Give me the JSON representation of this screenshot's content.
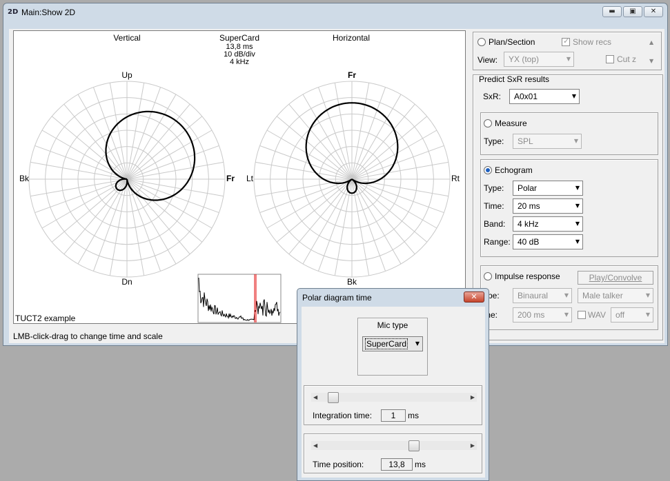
{
  "window": {
    "icon_text": "2D",
    "title": "Main:Show 2D",
    "minimize_glyph": "▬",
    "maximize_glyph": "▣",
    "close_glyph": "✕"
  },
  "plot": {
    "header": {
      "mic_type": "SuperCard",
      "time": "13,8 ms",
      "scale": "10 dB/div",
      "band": "4 kHz"
    },
    "vertical": {
      "title": "Vertical",
      "top": "Up",
      "bottom": "Dn",
      "left": "Bk",
      "right": "Fr"
    },
    "horizontal": {
      "title": "Horizontal",
      "top": "Fr",
      "bottom": "Bk",
      "left": "Lt",
      "right": "Rt"
    },
    "example_label": "TUCT2 example"
  },
  "status_text": "LMB-click-drag to change time and scale",
  "panel": {
    "plan_section_label": "Plan/Section",
    "show_recs_label": "Show recs",
    "view_label": "View:",
    "view_value": "YX (top)",
    "cut_z_label": "Cut z",
    "predict_title": "Predict SxR results",
    "sxr_label": "SxR:",
    "sxr_value": "A0x01",
    "measure_label": "Measure",
    "measure_type_label": "Type:",
    "measure_type_value": "SPL",
    "echogram_label": "Echogram",
    "echo_type_label": "Type:",
    "echo_type_value": "Polar",
    "echo_time_label": "Time:",
    "echo_time_value": "20 ms",
    "echo_band_label": "Band:",
    "echo_band_value": "4 kHz",
    "echo_range_label": "Range:",
    "echo_range_value": "40 dB",
    "impulse_label": "Impulse response",
    "play_label": "Play/Convolve",
    "imp_type_label": "ype:",
    "imp_type_value": "Binaural",
    "imp_talker_value": "Male talker",
    "imp_time_label": "me:",
    "imp_time_value": "200 ms",
    "wav_label": "WAV",
    "wav_value": "off"
  },
  "dialog": {
    "title": "Polar diagram time",
    "close_glyph": "✕",
    "mic_type_label": "Mic type",
    "mic_type_value": "SuperCard",
    "integration_label": "Integration time:",
    "integration_value": "1",
    "integration_unit": "ms",
    "integration_position": 0.05,
    "time_position_label": "Time position:",
    "time_position_value": "13,8",
    "time_position_unit": "ms",
    "time_position_fraction": 0.65
  }
}
